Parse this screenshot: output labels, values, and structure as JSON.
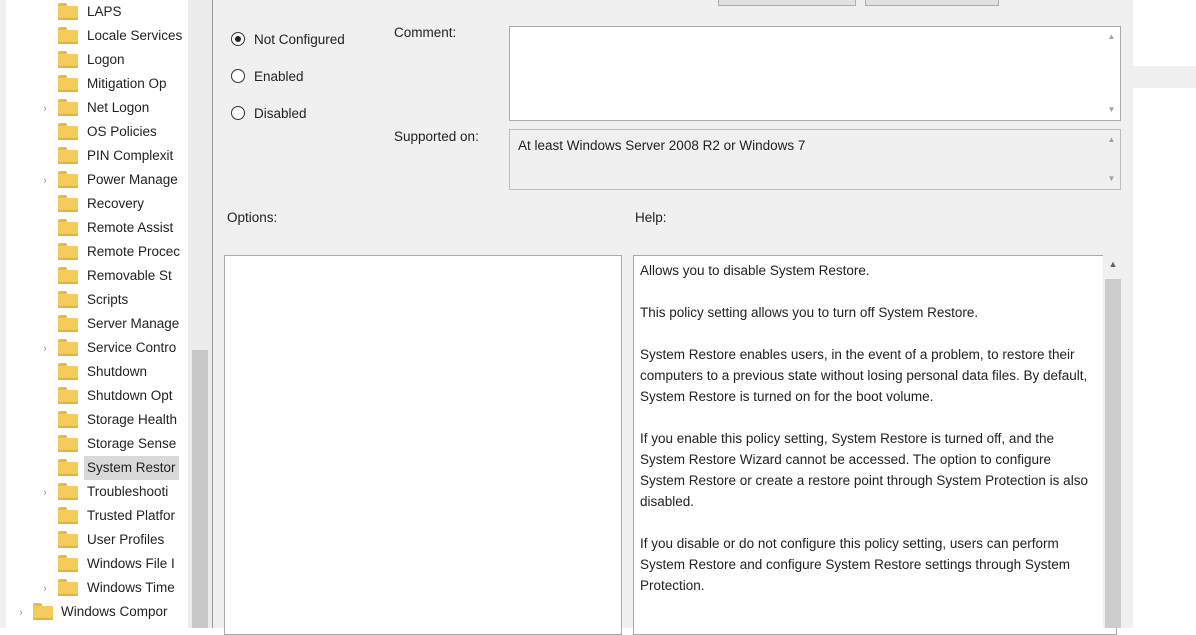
{
  "tree": {
    "items": [
      {
        "label": "LAPS",
        "expandable": false
      },
      {
        "label": "Locale Services",
        "expandable": false
      },
      {
        "label": "Logon",
        "expandable": false
      },
      {
        "label": "Mitigation Op",
        "expandable": false
      },
      {
        "label": "Net Logon",
        "expandable": true
      },
      {
        "label": "OS Policies",
        "expandable": false
      },
      {
        "label": "PIN Complexit",
        "expandable": false
      },
      {
        "label": "Power Manage",
        "expandable": true
      },
      {
        "label": "Recovery",
        "expandable": false
      },
      {
        "label": "Remote Assist",
        "expandable": false
      },
      {
        "label": "Remote Procec",
        "expandable": false
      },
      {
        "label": "Removable St",
        "expandable": false
      },
      {
        "label": "Scripts",
        "expandable": false
      },
      {
        "label": "Server Manage",
        "expandable": false
      },
      {
        "label": "Service Contro",
        "expandable": true
      },
      {
        "label": "Shutdown",
        "expandable": false
      },
      {
        "label": "Shutdown Opt",
        "expandable": false
      },
      {
        "label": "Storage Health",
        "expandable": false
      },
      {
        "label": "Storage Sense",
        "expandable": false
      },
      {
        "label": "System Restor",
        "expandable": false,
        "selected": true
      },
      {
        "label": "Troubleshooti",
        "expandable": true
      },
      {
        "label": "Trusted Platfor",
        "expandable": false
      },
      {
        "label": "User Profiles",
        "expandable": false
      },
      {
        "label": "Windows File I",
        "expandable": false
      },
      {
        "label": "Windows Time",
        "expandable": true
      },
      {
        "label": "Windows Compor",
        "expandable": true,
        "level": 0
      }
    ]
  },
  "dialog": {
    "radios": [
      {
        "label": "Not Configured",
        "checked": true
      },
      {
        "label": "Enabled",
        "checked": false
      },
      {
        "label": "Disabled",
        "checked": false
      }
    ],
    "comment_label": "Comment:",
    "comment_value": "",
    "supported_label": "Supported on:",
    "supported_value": "At least Windows Server 2008 R2 or Windows 7",
    "options_label": "Options:",
    "help_label": "Help:",
    "help_paragraphs": [
      "Allows you to disable System Restore.",
      "This policy setting allows you to turn off System Restore.",
      "System Restore enables users, in the event of a problem, to restore their computers to a previous state without losing personal data files. By default, System Restore is turned on for the boot volume.",
      "If you enable this policy setting, System Restore is turned off, and the System Restore Wizard cannot be accessed. The option to configure System Restore or create a restore point through System Protection is also disabled.",
      "If you disable or do not configure this policy setting, users can perform System Restore and configure System Restore settings through System Protection."
    ]
  },
  "icons": {
    "folder": "folder-icon",
    "expand": "chevron-right-icon",
    "scroll_up": "arrow-up-icon",
    "scroll_down": "arrow-down-icon"
  }
}
